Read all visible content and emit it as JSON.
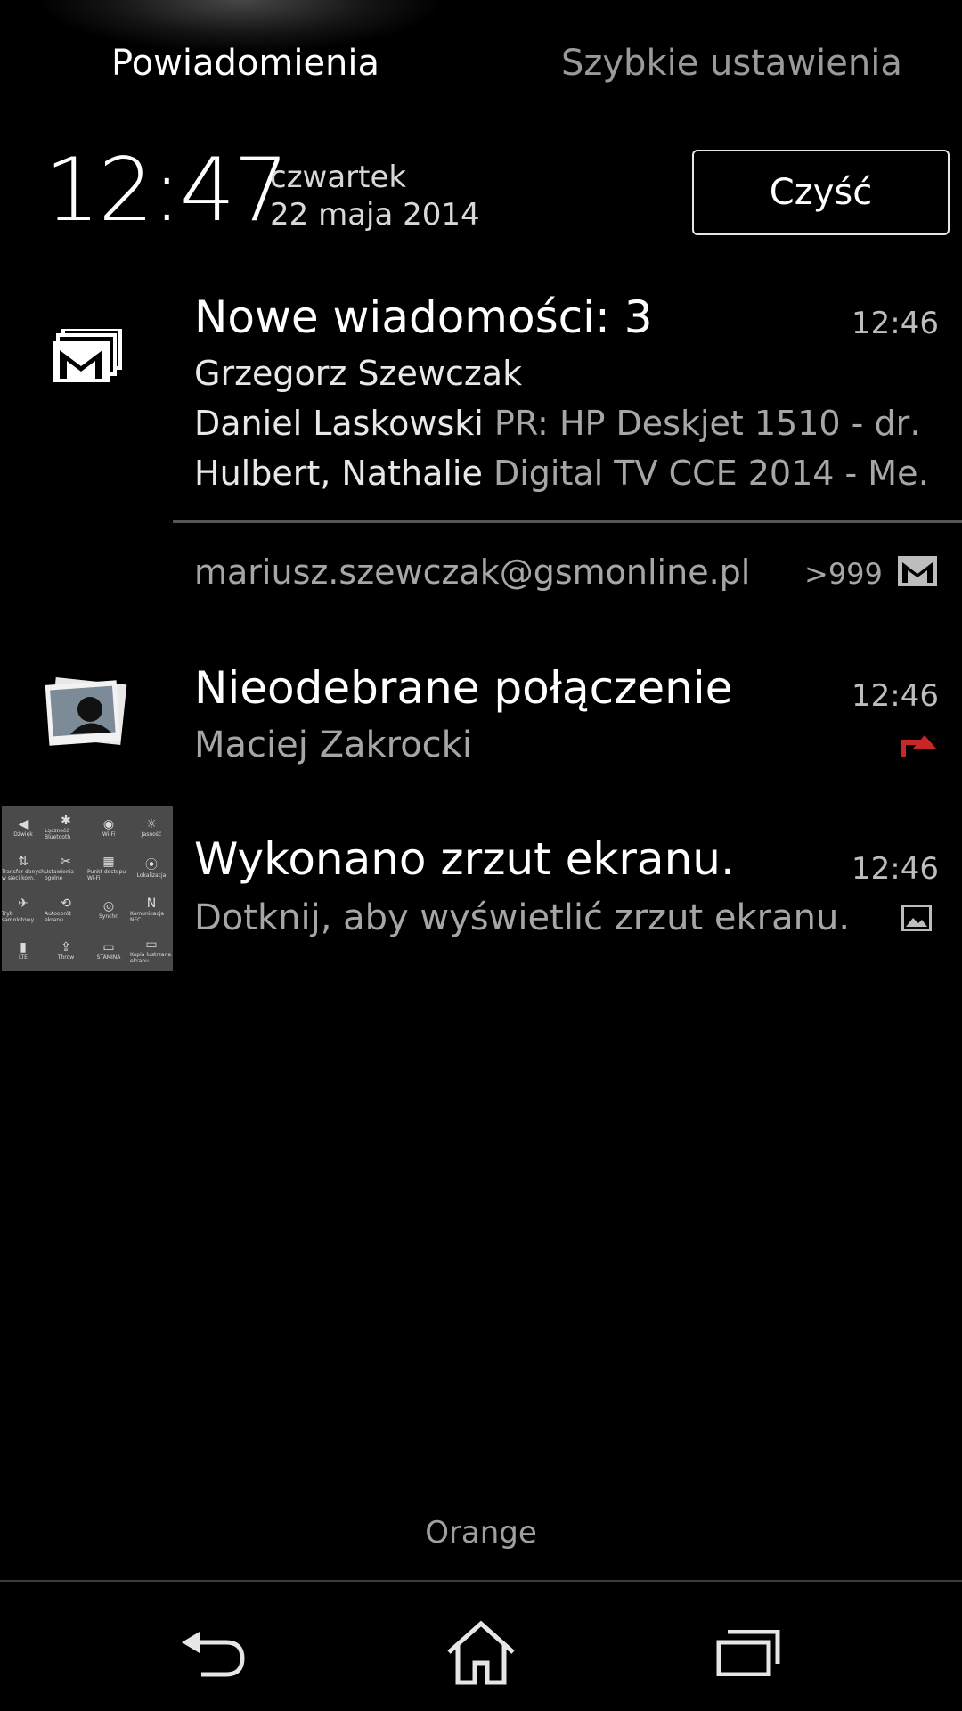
{
  "tabs": {
    "notifications": "Powiadomienia",
    "quick_settings": "Szybkie ustawienia"
  },
  "header": {
    "time": "12:47",
    "weekday": "czwartek",
    "date": "22 maja 2014",
    "clear_label": "Czyść"
  },
  "email_notification": {
    "icon": "gmail-multi-icon",
    "title": "Nowe wiadomości: 3",
    "time": "12:46",
    "lines": [
      {
        "sender": "Grzegorz Szewczak",
        "subject": ""
      },
      {
        "sender": "Daniel Laskowski",
        "subject": "PR: HP Deskjet 1510 - dr…"
      },
      {
        "sender": "Hulbert, Nathalie",
        "subject": "Digital TV CCE 2014 - Me…"
      }
    ],
    "account": "mariusz.szewczak@gsmonline.pl",
    "count": ">999",
    "account_icon": "gmail-icon"
  },
  "missed_call": {
    "icon": "contact-photo",
    "title": "Nieodebrane połączenie",
    "contact": "Maciej Zakrocki",
    "time": "12:46",
    "status_icon": "missed-call-icon",
    "status_color": "#c62828"
  },
  "screenshot": {
    "title": "Wykonano zrzut ekranu.",
    "subtitle": "Dotknij, aby wyświetlić zrzut ekranu.",
    "time": "12:46",
    "status_icon": "image-icon",
    "thumbnail_labels": [
      "Dźwięk",
      "Łączność Bluetooth",
      "Wi-Fi",
      "Jasność",
      "Transfer danych w sieci kom.",
      "Ustawienia ogólne",
      "Punkt dostępu Wi-Fi",
      "Lokalizacja",
      "Tryb samolotowy",
      "Autoobrót ekranu",
      "Synchr.",
      "Komunikacja NFC",
      "LTE",
      "Throw",
      "STAMINA",
      "Kopia lustrzana ekranu"
    ]
  },
  "operator": "Orange",
  "navigation": {
    "back": "back-icon",
    "home": "home-icon",
    "recents": "recents-icon"
  }
}
